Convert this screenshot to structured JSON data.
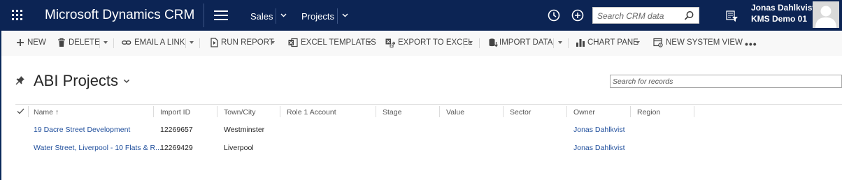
{
  "nav": {
    "brand": "Microsoft Dynamics CRM",
    "area": "Sales",
    "entity": "Projects",
    "search_placeholder": "Search CRM data",
    "user_name": "Jonas Dahlkvist",
    "org_name": "KMS Demo 01",
    "background_color": "#0c2454"
  },
  "commands": {
    "new": "NEW",
    "delete": "DELETE",
    "email_link": "EMAIL A LINK",
    "run_report": "RUN REPORT",
    "excel_templates": "EXCEL TEMPLATES",
    "export_excel": "EXPORT TO EXCEL",
    "import_data": "IMPORT DATA",
    "chart_pane": "CHART PANE",
    "new_system_view": "NEW SYSTEM VIEW",
    "more": "•••"
  },
  "view": {
    "title": "ABI Projects",
    "search_placeholder": "Search for records"
  },
  "grid": {
    "columns": [
      "Name ↑",
      "Import ID",
      "Town/City",
      "Role 1 Account",
      "Stage",
      "Value",
      "Sector",
      "Owner",
      "Region"
    ],
    "rows": [
      {
        "name": "19 Dacre Street Development",
        "import_id": "12269657",
        "town": "Westminster",
        "owner": "Jonas Dahlkvist"
      },
      {
        "name": "Water Street, Liverpool - 10 Flats & R...",
        "import_id": "12269429",
        "town": "Liverpool",
        "owner": "Jonas Dahlkvist"
      }
    ]
  }
}
